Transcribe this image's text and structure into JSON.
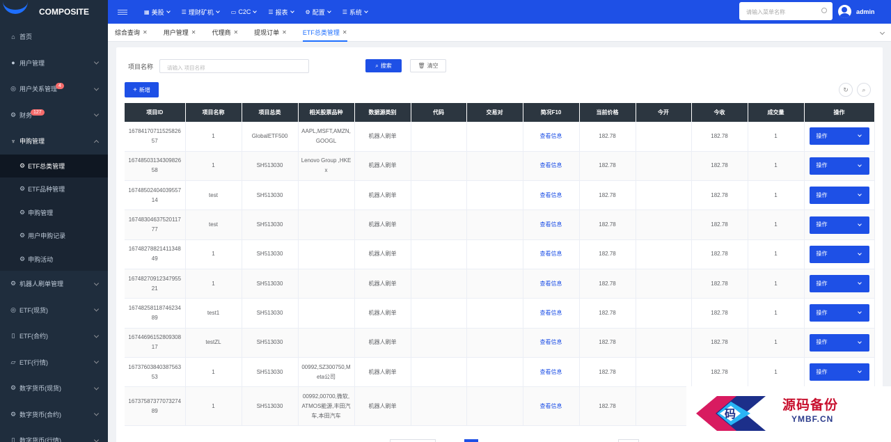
{
  "app": {
    "name": "COMPOSITE"
  },
  "sidebar": {
    "items": [
      {
        "label": "首页",
        "icon": "home-icon"
      },
      {
        "label": "用户管理",
        "icon": "user-icon"
      },
      {
        "label": "用户关系管理",
        "icon": "relation-icon",
        "badge": "4"
      },
      {
        "label": "财务",
        "icon": "finance-icon",
        "badge": "127"
      },
      {
        "label": "申购管理",
        "icon": "subscribe-icon"
      },
      {
        "label": "机器人刷单管理",
        "icon": "robot-icon"
      },
      {
        "label": "ETF(现货)",
        "icon": "etf-icon"
      },
      {
        "label": "ETF(合约)",
        "icon": "contract-icon"
      },
      {
        "label": "ETF(行情)",
        "icon": "quote-icon"
      },
      {
        "label": "数字货币(现货)",
        "icon": "coin-icon"
      },
      {
        "label": "数字货币(合约)",
        "icon": "coin-contract-icon"
      },
      {
        "label": "数字货币(行情)",
        "icon": "coin-quote-icon"
      }
    ],
    "subitems": [
      {
        "label": "ETF总类管理"
      },
      {
        "label": "ETF品种管理"
      },
      {
        "label": "申购管理"
      },
      {
        "label": "用户申购记录"
      },
      {
        "label": "申购活动"
      }
    ]
  },
  "topbar": {
    "nav": [
      "美股",
      "理财矿机",
      "C2C",
      "报表",
      "配置",
      "系统"
    ],
    "search_placeholder": "请输入菜单名称",
    "user": "admin"
  },
  "tabs": [
    {
      "label": "综合查询"
    },
    {
      "label": "用户管理"
    },
    {
      "label": "代理商"
    },
    {
      "label": "提现订单"
    },
    {
      "label": "ETF总类管理"
    }
  ],
  "filter": {
    "label": "项目名称",
    "placeholder": "请输入 项目名称",
    "search": "搜索",
    "reset": "清空",
    "add": "新增"
  },
  "table": {
    "headers": [
      "项目ID",
      "项目名称",
      "项目总类",
      "相关股票品种",
      "数据源类别",
      "代码",
      "交易对",
      "简况F10",
      "当前价格",
      "今开",
      "今收",
      "成交量",
      "操作"
    ],
    "rows": [
      {
        "id": "1678417071152582657",
        "name": "1",
        "type": "GlobalETF500",
        "stocks": "AAPL,MSFT,AMZN,GOOGL",
        "source": "机器人刷单",
        "code": "",
        "pair": "",
        "f10": "查看信息",
        "price": "182.78",
        "open": "",
        "close": "182.78",
        "volume": "1",
        "op": "操作"
      },
      {
        "id": "1674850313430982658",
        "name": "1",
        "type": "SH513030",
        "stocks": "Lenovo Group ,HKEx",
        "source": "机器人刷单",
        "code": "",
        "pair": "",
        "f10": "查看信息",
        "price": "182.78",
        "open": "",
        "close": "182.78",
        "volume": "1",
        "op": "操作"
      },
      {
        "id": "1674850240403955714",
        "name": "test",
        "type": "SH513030",
        "stocks": "",
        "source": "机器人刷单",
        "code": "",
        "pair": "",
        "f10": "查看信息",
        "price": "182.78",
        "open": "",
        "close": "182.78",
        "volume": "1",
        "op": "操作"
      },
      {
        "id": "1674830463752011777",
        "name": "test",
        "type": "SH513030",
        "stocks": "",
        "source": "机器人刷单",
        "code": "",
        "pair": "",
        "f10": "查看信息",
        "price": "182.78",
        "open": "",
        "close": "182.78",
        "volume": "1",
        "op": "操作"
      },
      {
        "id": "1674827882141134849",
        "name": "1",
        "type": "SH513030",
        "stocks": "",
        "source": "机器人刷单",
        "code": "",
        "pair": "",
        "f10": "查看信息",
        "price": "182.78",
        "open": "",
        "close": "182.78",
        "volume": "1",
        "op": "操作"
      },
      {
        "id": "1674827091234795521",
        "name": "1",
        "type": "SH513030",
        "stocks": "",
        "source": "机器人刷单",
        "code": "",
        "pair": "",
        "f10": "查看信息",
        "price": "182.78",
        "open": "",
        "close": "182.78",
        "volume": "1",
        "op": "操作"
      },
      {
        "id": "1674825811874623489",
        "name": "test1",
        "type": "SH513030",
        "stocks": "",
        "source": "机器人刷单",
        "code": "",
        "pair": "",
        "f10": "查看信息",
        "price": "182.78",
        "open": "",
        "close": "182.78",
        "volume": "1",
        "op": "操作"
      },
      {
        "id": "1674469615280930817",
        "name": "testZL",
        "type": "SH513030",
        "stocks": "",
        "source": "机器人刷单",
        "code": "",
        "pair": "",
        "f10": "查看信息",
        "price": "182.78",
        "open": "",
        "close": "182.78",
        "volume": "1",
        "op": "操作"
      },
      {
        "id": "1673760384038756353",
        "name": "1",
        "type": "SH513030",
        "stocks": "00992,SZ300750,Meta公司",
        "source": "机器人刷单",
        "code": "",
        "pair": "",
        "f10": "查看信息",
        "price": "182.78",
        "open": "",
        "close": "182.78",
        "volume": "1",
        "op": "操作"
      },
      {
        "id": "1673758737707327489",
        "name": "1",
        "type": "SH513030",
        "stocks": "00992,00700,微软,ATMOS能源,丰田汽车,本田汽车",
        "source": "机器人刷单",
        "code": "",
        "pair": "",
        "f10": "查看信息",
        "price": "182.78",
        "open": "",
        "close": "",
        "volume": "",
        "op": ""
      }
    ]
  },
  "watermark": {
    "cn": "源码备份",
    "en": "YMBF.CN",
    "glyph": "码"
  },
  "colors": {
    "primary": "#1e50e6",
    "sidebar": "#1f2d3d",
    "header": "#2c3640",
    "badge": "#f56c6c"
  }
}
